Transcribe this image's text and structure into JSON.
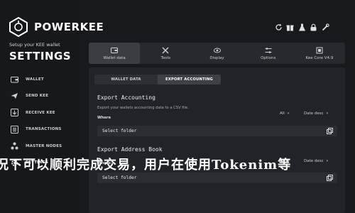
{
  "brand": {
    "name": "POWERKEE"
  },
  "sidebar": {
    "setup_text": "Setup your KEE wallet",
    "title": "SETTINGS",
    "items": [
      {
        "label": "WALLET",
        "icon": "wallet-icon"
      },
      {
        "label": "SEND KEE",
        "icon": "send-icon"
      },
      {
        "label": "RECEIVE KEE",
        "icon": "receive-icon"
      },
      {
        "label": "TRANSACTIONS",
        "icon": "transactions-icon"
      },
      {
        "label": "MASTER NODES",
        "icon": "masternodes-icon"
      },
      {
        "label": "SETTINGS",
        "icon": "gear-icon"
      }
    ]
  },
  "top_icons": [
    "refresh-icon",
    "gift-icon",
    "flask-icon",
    "lock-icon",
    "tools-icon"
  ],
  "tabs": [
    {
      "label": "Wallet data",
      "icon": "wallet-data-icon",
      "active": true
    },
    {
      "label": "Tools",
      "icon": "tools-icon"
    },
    {
      "label": "Display",
      "icon": "display-icon"
    },
    {
      "label": "Options",
      "icon": "options-icon"
    },
    {
      "label": "Kee Core V4.9",
      "icon": "core-icon"
    }
  ],
  "subtabs": [
    {
      "label": "WALLET DATA",
      "active": false
    },
    {
      "label": "EXPORT ACCOUNTING",
      "active": true
    }
  ],
  "export_accounting": {
    "title": "Export Accounting",
    "description": "Export your wallets accounting data to a CSV file.",
    "where_label": "Where",
    "filter_value": "All",
    "sort_value": "Date desc",
    "folder_placeholder": "Select folder"
  },
  "export_address_book": {
    "title": "Export Address Book",
    "where_label": "Where",
    "filter_value": "All",
    "sort_value": "Date desc",
    "folder_placeholder": "Select folder"
  },
  "overlay_text": "况下可以顺利完成交易，用户在使用Tokenim等"
}
